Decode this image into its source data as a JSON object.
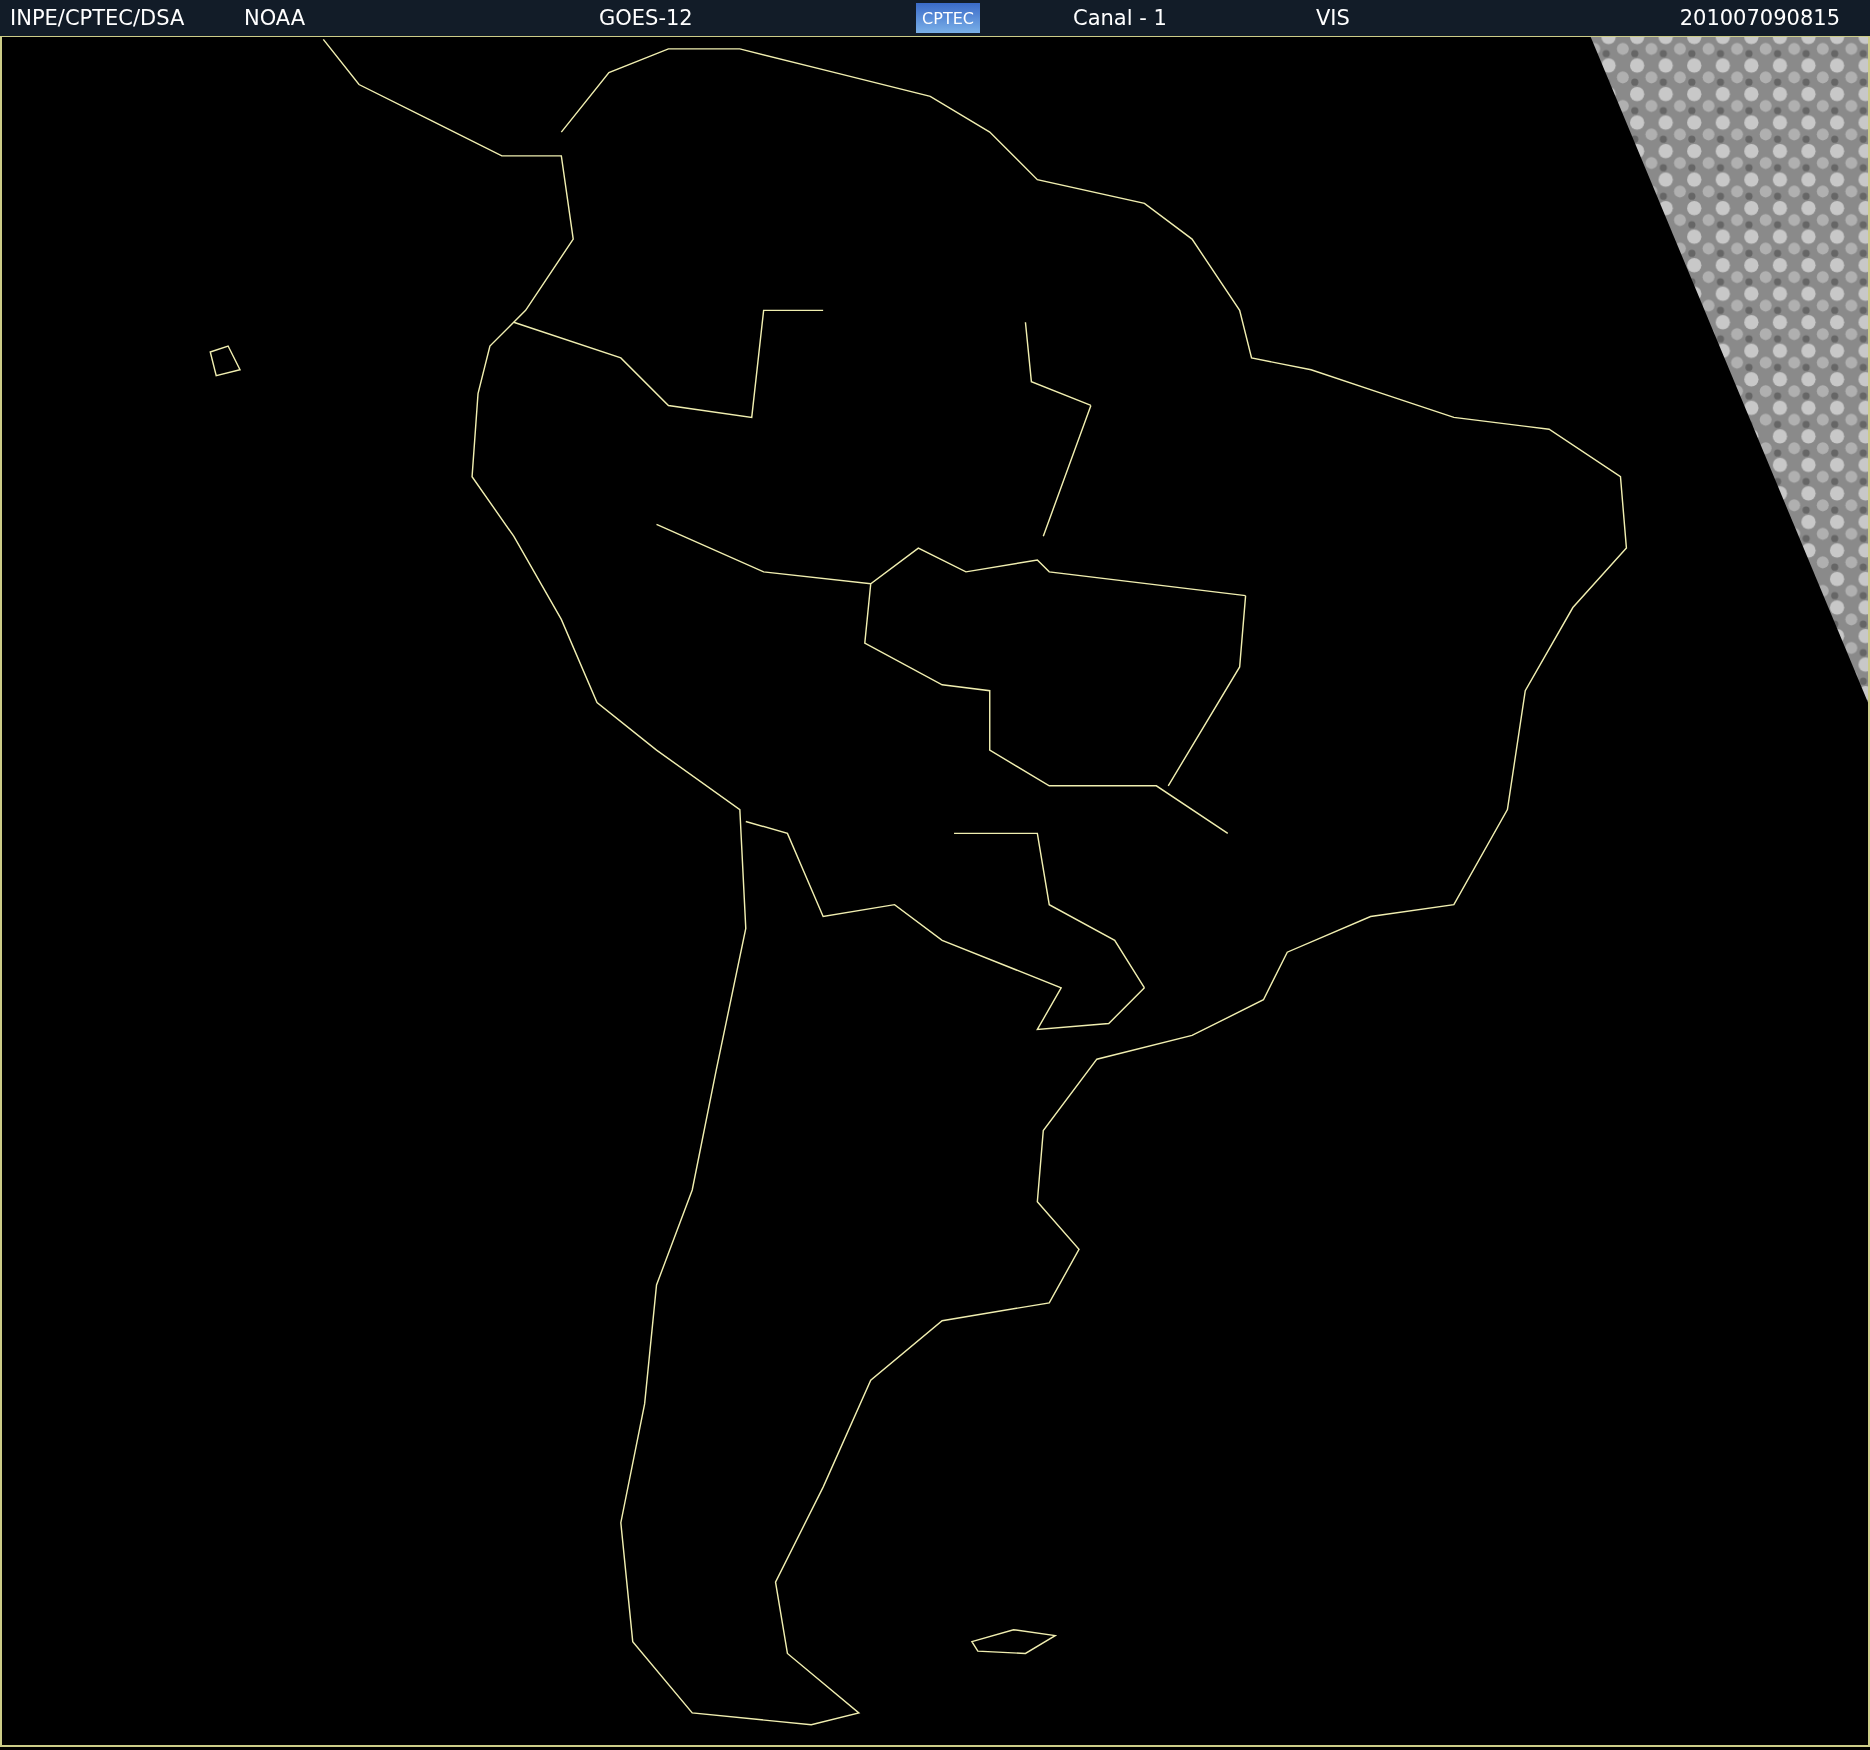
{
  "header": {
    "source": "INPE/CPTEC/DSA",
    "agency": "NOAA",
    "satellite": "GOES-12",
    "logo_text": "CPTEC",
    "channel": "Canal - 1",
    "band": "VIS",
    "timestamp": "201007090815"
  }
}
